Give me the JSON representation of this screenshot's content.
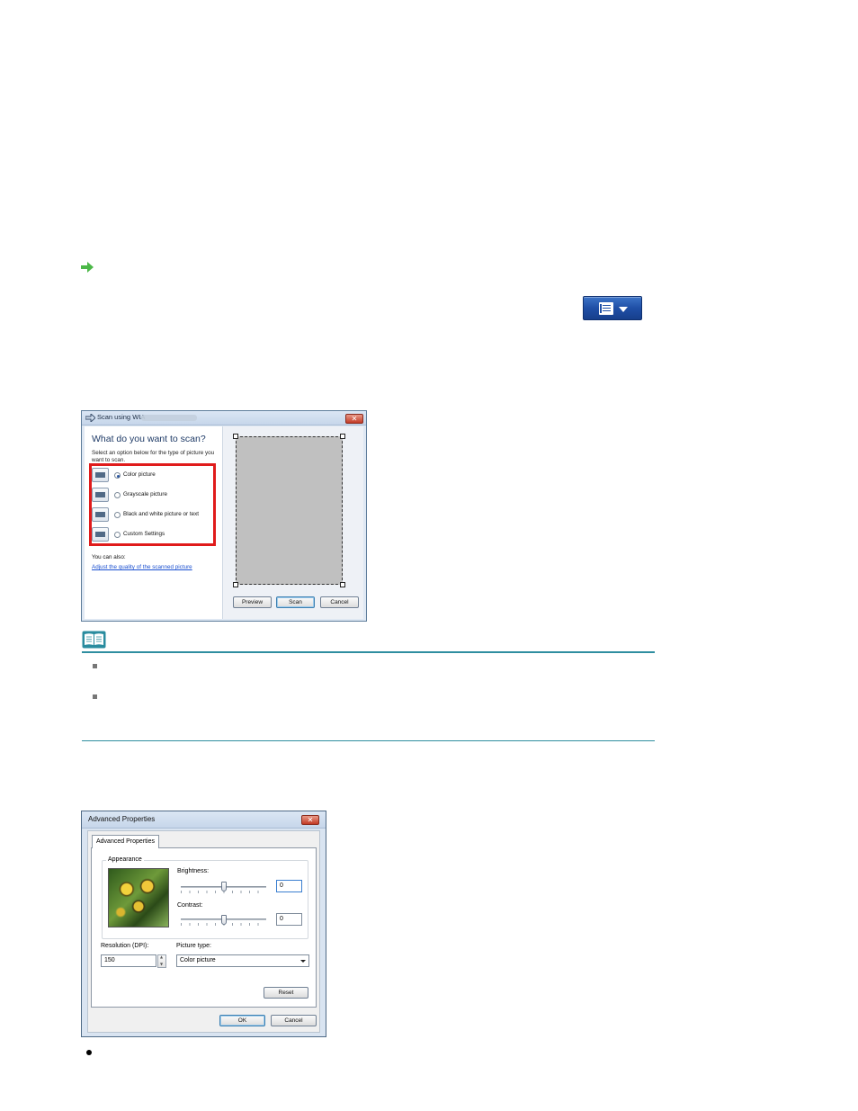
{
  "colors": {
    "accent_teal": "#2f8ea0",
    "highlight_red": "#e01b1b",
    "link_blue": "#1a4fd0",
    "button_blue": "#1f4fa6"
  },
  "icons": {
    "arrow": "green-arrow-icon",
    "menu": "document-menu-icon",
    "note": "book-note-icon"
  },
  "scan_dialog": {
    "title": "Scan using WIA",
    "close": "✕",
    "heading": "What do you want to scan?",
    "instruction": "Select an option below for the type of picture you want to scan.",
    "options": [
      {
        "label": "Color picture",
        "selected": true
      },
      {
        "label": "Grayscale picture",
        "selected": false
      },
      {
        "label": "Black and white picture or text",
        "selected": false
      },
      {
        "label": "Custom Settings",
        "selected": false
      }
    ],
    "you_can_also": "You can also:",
    "adjust_link": "Adjust the quality of the scanned picture",
    "buttons": {
      "preview": "Preview",
      "scan": "Scan",
      "cancel": "Cancel"
    }
  },
  "advanced_dialog": {
    "title": "Advanced Properties",
    "close": "✕",
    "tab": "Advanced Properties",
    "appearance": "Appearance",
    "brightness_label": "Brightness:",
    "brightness_value": "0",
    "contrast_label": "Contrast:",
    "contrast_value": "0",
    "resolution_label": "Resolution (DPI):",
    "resolution_value": "150",
    "picture_type_label": "Picture type:",
    "picture_type_value": "Color picture",
    "buttons": {
      "reset": "Reset",
      "ok": "OK",
      "cancel": "Cancel"
    }
  }
}
